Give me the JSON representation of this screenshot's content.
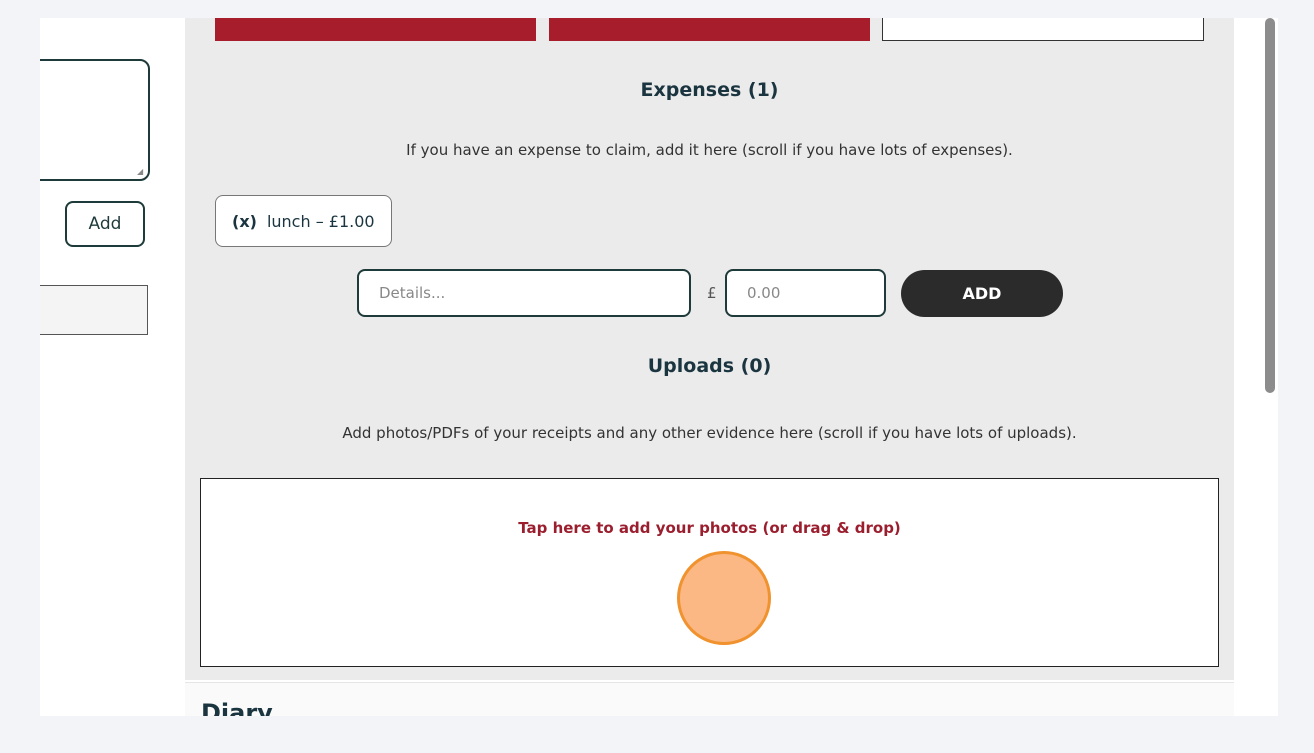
{
  "left": {
    "add_label": "Add"
  },
  "expenses": {
    "title": "Expenses (1)",
    "description": "If you have an expense to claim, add it here (scroll if you have lots of expenses).",
    "items": [
      {
        "remove_label": "(x)",
        "label": "lunch – £1.00"
      }
    ],
    "details_placeholder": "Details...",
    "currency_symbol": "£",
    "amount_placeholder": "0.00",
    "add_label": "ADD"
  },
  "uploads": {
    "title": "Uploads (0)",
    "description": "Add photos/PDFs of your receipts and any other evidence here (scroll if you have lots of uploads).",
    "dropzone_label": "Tap here to add your photos (or drag & drop)"
  },
  "diary": {
    "title": "Diary"
  },
  "colors": {
    "accent_red": "#a81d2b",
    "dark_teal": "#1a3540",
    "button_dark": "#2b2b2b",
    "click_marker": "#f0922e"
  }
}
